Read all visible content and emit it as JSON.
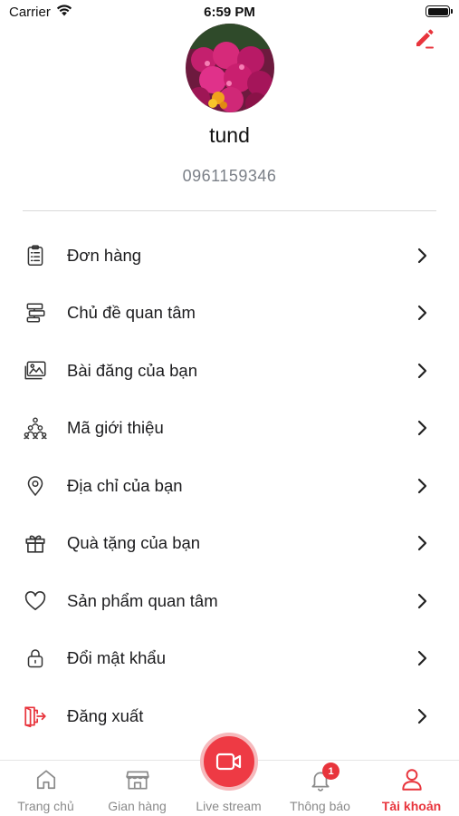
{
  "status_bar": {
    "carrier": "Carrier",
    "time": "6:59 PM"
  },
  "profile": {
    "username": "tund",
    "phone": "0961159346",
    "edit_icon": "pencil-icon",
    "avatar": "flower-photo"
  },
  "menu": {
    "items": [
      {
        "label": "Đơn hàng",
        "icon": "clipboard-list-icon"
      },
      {
        "label": "Chủ đề quan tâm",
        "icon": "signpost-icon"
      },
      {
        "label": "Bài đăng của bạn",
        "icon": "images-icon"
      },
      {
        "label": "Mã giới thiệu",
        "icon": "referral-network-icon"
      },
      {
        "label": "Địa chỉ của bạn",
        "icon": "location-pin-icon"
      },
      {
        "label": "Quà tặng của bạn",
        "icon": "gift-icon"
      },
      {
        "label": "Sản phẩm quan tâm",
        "icon": "heart-icon"
      },
      {
        "label": "Đổi mật khẩu",
        "icon": "lock-icon"
      },
      {
        "label": "Đăng xuất",
        "icon": "logout-icon"
      }
    ]
  },
  "tab_bar": {
    "tabs": [
      {
        "label": "Trang chủ",
        "icon": "home-icon"
      },
      {
        "label": "Gian hàng",
        "icon": "store-icon"
      },
      {
        "label": "Live stream",
        "icon": "video-camera-icon"
      },
      {
        "label": "Thông báo",
        "icon": "bell-icon",
        "badge": "1"
      },
      {
        "label": "Tài khoản",
        "icon": "user-icon",
        "active": true
      }
    ]
  },
  "colors": {
    "accent": "#e8343c",
    "text": "#1c1c1e",
    "muted": "#7a7f87",
    "tab_inactive": "#8a8a8a"
  }
}
